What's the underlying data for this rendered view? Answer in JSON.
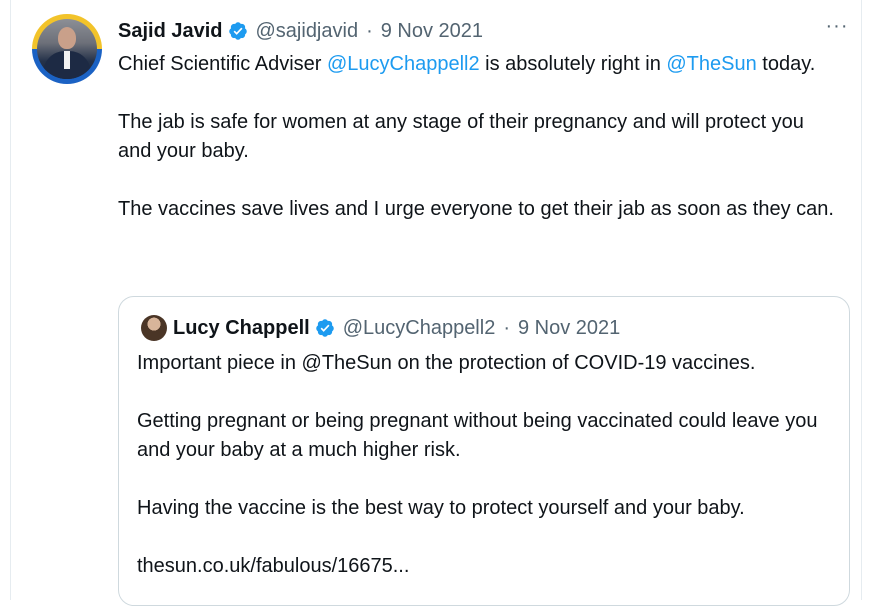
{
  "tweet": {
    "author_name": "Sajid Javid",
    "handle": "@sajidjavid",
    "separator": "·",
    "date": "9 Nov 2021",
    "more_label": "···",
    "line1_pre": "Chief Scientific Adviser ",
    "mention_1": "@LucyChappell2",
    "line1_mid": " is absolutely right in ",
    "mention_2": "@TheSun",
    "line1_post": " today.",
    "paragraph_2": "The jab is safe for women at any stage of their pregnancy and will protect you and your baby.",
    "paragraph_3": "The vaccines save lives and I urge everyone to get their jab as soon as they can."
  },
  "quote": {
    "author_name": "Lucy Chappell",
    "handle": "@LucyChappell2",
    "separator": "·",
    "date": "9 Nov 2021",
    "paragraph_1": "Important piece in @TheSun on the protection of COVID-19 vaccines.",
    "paragraph_2": "Getting pregnant or being pregnant without being vaccinated could leave you and your baby at a much higher risk.",
    "paragraph_3": "Having the vaccine is the best way to protect yourself and your baby.",
    "link_text": "thesun.co.uk/fabulous/16675..."
  },
  "colors": {
    "mention": "#1d9bf0",
    "verified": "#1d9bf0",
    "muted_text": "#536471",
    "border": "#cfd9de"
  },
  "icons": {
    "verified": "verified-badge-icon",
    "more": "more-options-icon"
  }
}
